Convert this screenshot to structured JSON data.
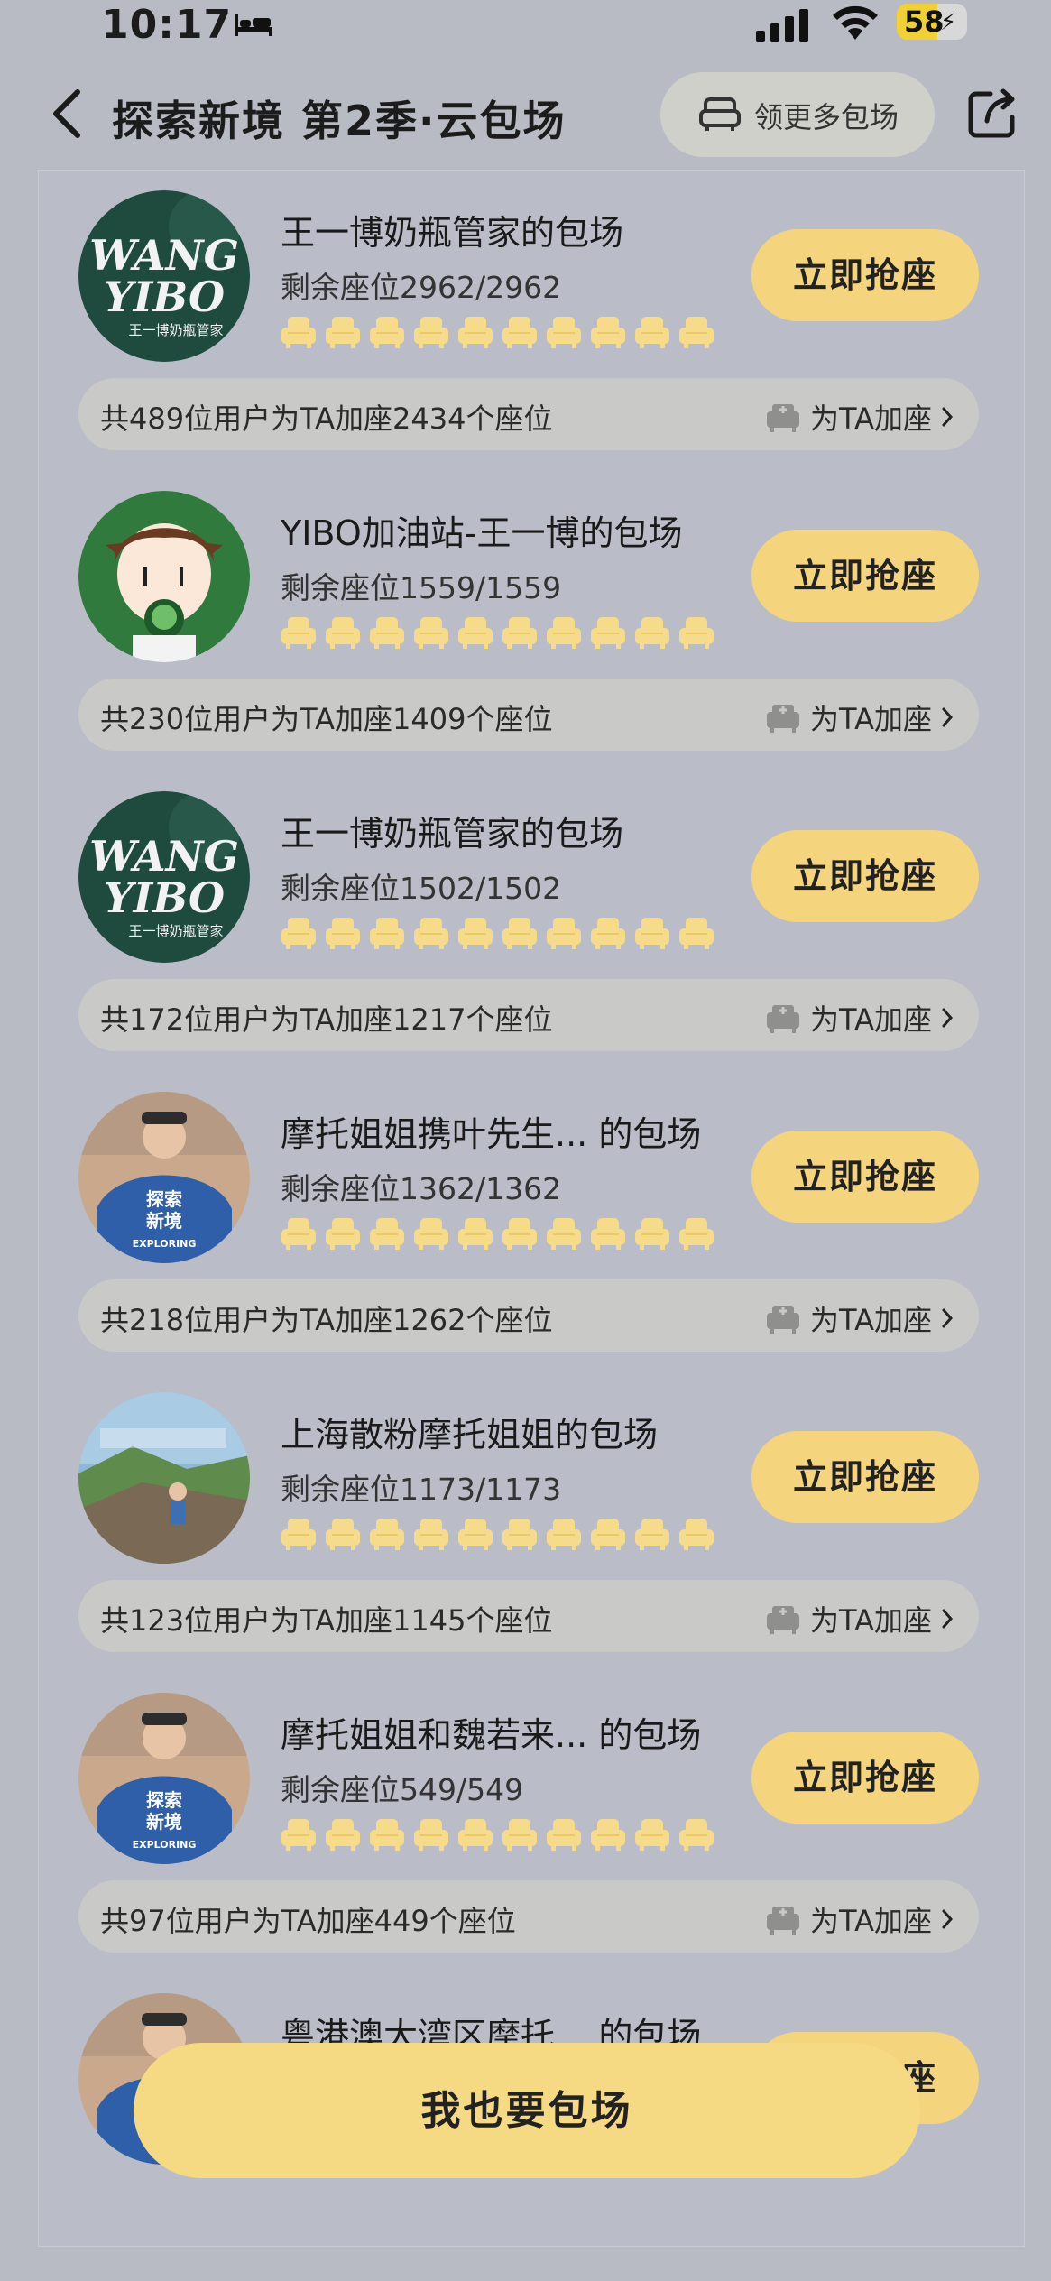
{
  "status_bar": {
    "time": "10:17",
    "battery": "58"
  },
  "nav": {
    "title": "探索新境 第2季·云包场",
    "more_label": "领更多包场"
  },
  "cards": [
    {
      "name": "王一博奶瓶管家的包场",
      "remaining": "剩余座位2962/2962",
      "grab_label": "立即抢座",
      "stat": "共489位用户为TA加座2434个座位",
      "add_label": "为TA加座",
      "avatar": "wangyibo-logo"
    },
    {
      "name": "YIBO加油站-王一博的包场",
      "remaining": "剩余座位1559/1559",
      "grab_label": "立即抢座",
      "stat": "共230位用户为TA加座1409个座位",
      "add_label": "为TA加座",
      "avatar": "cartoon-boy"
    },
    {
      "name": "王一博奶瓶管家的包场",
      "remaining": "剩余座位1502/1502",
      "grab_label": "立即抢座",
      "stat": "共172位用户为TA加座1217个座位",
      "add_label": "为TA加座",
      "avatar": "wangyibo-logo"
    },
    {
      "name": "摩托姐姐携叶先生... 的包场",
      "remaining": "剩余座位1362/1362",
      "grab_label": "立即抢座",
      "stat": "共218位用户为TA加座1262个座位",
      "add_label": "为TA加座",
      "avatar": "exploring-photo"
    },
    {
      "name": "上海散粉摩托姐姐的包场",
      "remaining": "剩余座位1173/1173",
      "grab_label": "立即抢座",
      "stat": "共123位用户为TA加座1145个座位",
      "add_label": "为TA加座",
      "avatar": "climbing-photo"
    },
    {
      "name": "摩托姐姐和魏若来... 的包场",
      "remaining": "剩余座位549/549",
      "grab_label": "立即抢座",
      "stat": "共97位用户为TA加座449个座位",
      "add_label": "为TA加座",
      "avatar": "exploring-photo"
    },
    {
      "name": "粤港澳大湾区摩托... 的包场",
      "remaining": "",
      "grab_label": "立即抢座",
      "stat": "",
      "add_label": "",
      "avatar": "exploring-photo"
    }
  ],
  "cta_label": "我也要包场",
  "avatar_text": {
    "wang_top": "WANG",
    "wang_bottom": "YIBO",
    "wang_sub": "王一博奶瓶管家",
    "explore_cn1": "探索",
    "explore_cn2": "新境",
    "explore_en": "EXPLORING"
  },
  "colors": {
    "background": "#b9bbc4",
    "button_yellow": "#f4d57d",
    "seat_yellow": "#f6dc8a",
    "bar_gray": "#c9cac7"
  }
}
